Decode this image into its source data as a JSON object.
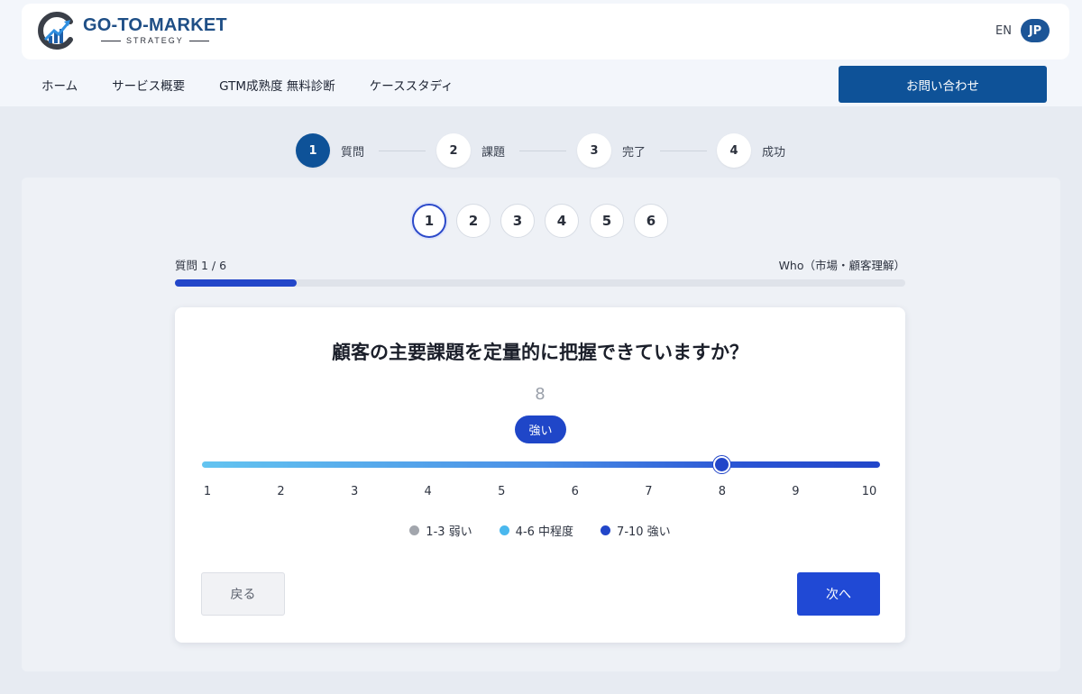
{
  "header": {
    "logo_title": "GO-TO-MARKET",
    "logo_subtitle": "STRATEGY",
    "lang_en": "EN",
    "lang_jp": "JP"
  },
  "nav": {
    "items": [
      "ホーム",
      "サービス概要",
      "GTM成熟度 無料診断",
      "ケーススタディ"
    ],
    "contact": "お問い合わせ"
  },
  "stepper": {
    "steps": [
      {
        "num": "1",
        "label": "質問",
        "active": true
      },
      {
        "num": "2",
        "label": "課題",
        "active": false
      },
      {
        "num": "3",
        "label": "完了",
        "active": false
      },
      {
        "num": "4",
        "label": "成功",
        "active": false
      }
    ]
  },
  "questions": {
    "numbers": [
      "1",
      "2",
      "3",
      "4",
      "5",
      "6"
    ],
    "active": "1"
  },
  "progress": {
    "label": "質問 1 / 6",
    "category": "Who（市場・顧客理解）",
    "fraction": 0.1667
  },
  "card": {
    "question": "顧客の主要課題を定量的に把握できていますか？",
    "score": "8",
    "strength": "強い",
    "slider_value": 8,
    "slider_min": 1,
    "slider_max": 10,
    "ticks": [
      "1",
      "2",
      "3",
      "4",
      "5",
      "6",
      "7",
      "8",
      "9",
      "10"
    ],
    "legend": [
      {
        "label": "1-3 弱い",
        "color": "#a2a6ad"
      },
      {
        "label": "4-6 中程度",
        "color": "#4ab8ee"
      },
      {
        "label": "7-10 強い",
        "color": "#2246c9"
      }
    ],
    "back": "戻る",
    "next": "次へ"
  },
  "colors": {
    "brand": "#0e5298",
    "accent": "#2246c9"
  }
}
